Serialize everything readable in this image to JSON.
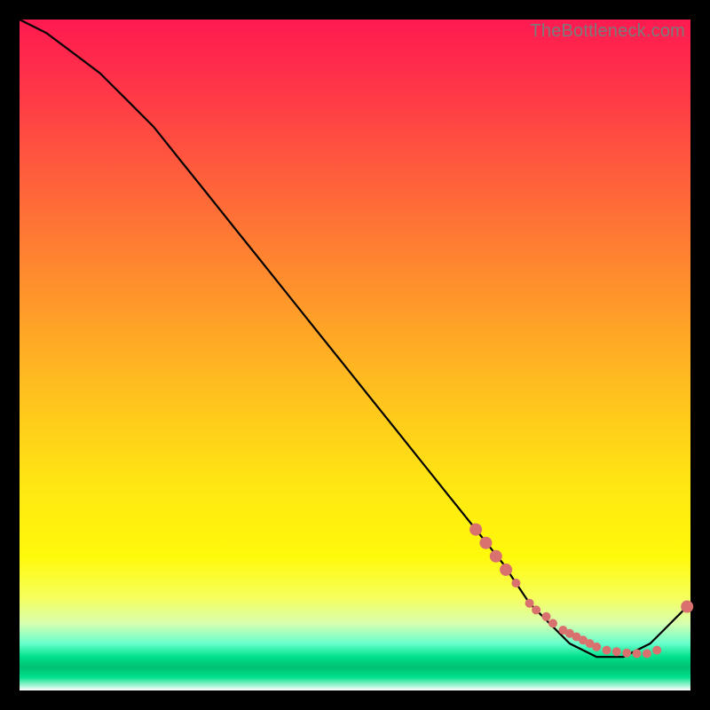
{
  "watermark": "TheBottleneck.com",
  "colors": {
    "dot": "#d9716f",
    "line": "#000000"
  },
  "chart_data": {
    "type": "line",
    "title": "",
    "xlabel": "",
    "ylabel": "",
    "xlim": [
      0,
      100
    ],
    "ylim": [
      0,
      100
    ],
    "grid": false,
    "series": [
      {
        "name": "bottleneck-curve",
        "x": [
          0,
          4,
          8,
          12,
          16,
          20,
          24,
          28,
          32,
          36,
          40,
          44,
          48,
          52,
          56,
          60,
          64,
          68,
          72,
          74,
          76,
          78,
          80,
          82,
          84,
          86,
          88,
          90,
          92,
          94,
          96,
          98,
          100
        ],
        "values": [
          100,
          98,
          95,
          92,
          88,
          84,
          79,
          74,
          69,
          64,
          59,
          54,
          49,
          44,
          39,
          34,
          29,
          24,
          19,
          16,
          13,
          11,
          9,
          7,
          6,
          5,
          5,
          5,
          6,
          7,
          9,
          11,
          13
        ]
      }
    ],
    "highlight_points": {
      "name": "marker-cluster",
      "x": [
        68,
        69.5,
        71,
        72.5,
        74,
        76,
        77,
        78.5,
        79.5,
        81,
        82,
        83,
        84,
        85,
        86,
        87.5,
        89,
        90.5,
        92,
        93.5,
        95,
        99.5
      ],
      "values": [
        24,
        22,
        20,
        18,
        16,
        13,
        12,
        11,
        10,
        9,
        8.5,
        8,
        7.5,
        7,
        6.5,
        6,
        5.8,
        5.6,
        5.5,
        5.5,
        6,
        12.5
      ]
    }
  }
}
